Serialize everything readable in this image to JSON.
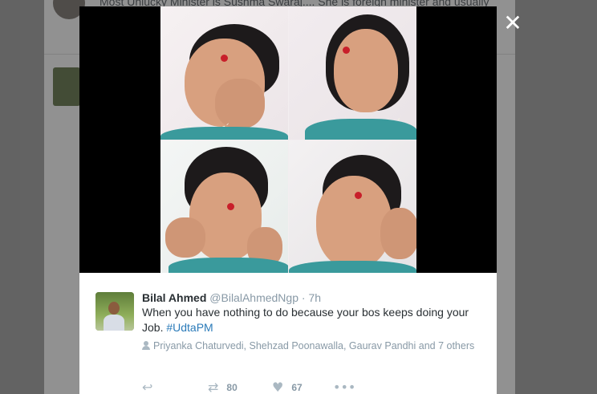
{
  "background": {
    "top_tweet_text": "Most Unlucky Minister is Sushma Swaraj.... She is foreign minister and usually"
  },
  "close_symbol": "✕",
  "tweet": {
    "name": "Bilal Ahmed",
    "handle": "@BilalAhmedNgp",
    "separator": "·",
    "time": "7h",
    "text": "When you have nothing to do because your bos  keeps doing your Job. ",
    "hashtag": "#UdtaPM",
    "mentions": "Priyanka Chaturvedi, Shehzad Poonawalla, Gaurav Pandhi and 7 others",
    "actions": {
      "reply_icon": "reply-icon",
      "retweet_icon": "retweet-icon",
      "retweet_count": "80",
      "like_icon": "heart-icon",
      "like_count": "67",
      "more_icon": "more-dots-icon"
    }
  },
  "colors": {
    "link": "#2b7bb9",
    "text": "#292f33",
    "muted": "#8899a6",
    "icon": "#aab8c2"
  }
}
